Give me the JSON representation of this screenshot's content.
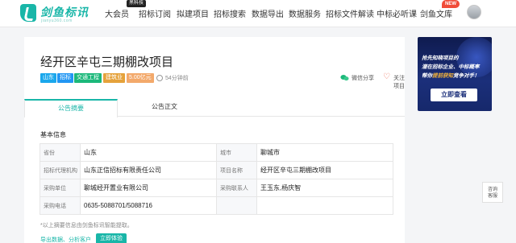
{
  "nav": {
    "brand": "剑鱼标讯",
    "brand_sub": "jianyu360.com",
    "items": [
      "大会员",
      "招标订阅",
      "拟建项目",
      "招标搜索",
      "数据导出",
      "数据服务",
      "招标文件解读",
      "中标必听课",
      "剑鱼文库"
    ],
    "badge_black": "黑科技",
    "badge_new": "NEW"
  },
  "project": {
    "title": "经开区辛屯三期棚改项目",
    "tags": [
      {
        "label": "山东",
        "color": "#1aa7ec"
      },
      {
        "label": "招标",
        "color": "#2196f3"
      },
      {
        "label": "交通工程",
        "color": "#1bb87a"
      },
      {
        "label": "建筑业",
        "color": "#e5a23b"
      },
      {
        "label": "5.00亿元",
        "color": "#f3a96b"
      }
    ],
    "time_ago": "54分钟前",
    "share_label": "微信分享",
    "follow_label": "关注项目"
  },
  "tabs": [
    "公告摘要",
    "公告正文"
  ],
  "basic_info": {
    "section_title": "基本信息",
    "rows": [
      [
        "省份",
        "山东",
        "城市",
        "聊城市"
      ],
      [
        "招标代理机构",
        "山东正信招标有限责任公司",
        "项目名称",
        "经开区辛屯三期棚改项目"
      ],
      [
        "采购单位",
        "聊城经开置业有限公司",
        "采购联系人",
        "王玉东,杨庆智"
      ],
      [
        "采购电话",
        "0635-5088701/5088716",
        "",
        ""
      ]
    ],
    "footnote": "*以上摘要信息由剑鱼标讯智能提取。",
    "export_link": "导出数据、分析客户",
    "try_button": "立即体验"
  },
  "ad": {
    "line1": "抢先知晓项目的",
    "line2": "潜在招标企业、中标概率",
    "line3_pre": "帮你",
    "line3_hl": "提前获知",
    "line3_post": "竞争对手！",
    "button": "立即查看"
  },
  "float_button": {
    "line1": "咨询",
    "line2": "客服"
  }
}
